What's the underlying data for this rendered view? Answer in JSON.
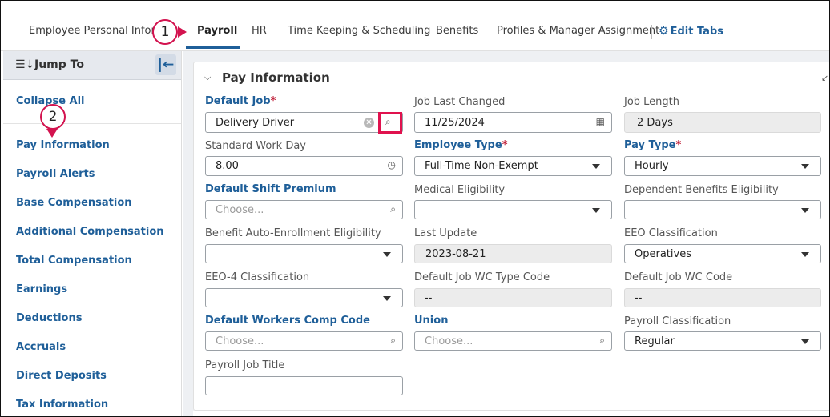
{
  "tabs": [
    {
      "label": "Employee Personal Informa"
    },
    {
      "label": "Payroll"
    },
    {
      "label": "HR"
    },
    {
      "label": "Time Keeping & Scheduling"
    },
    {
      "label": "Benefits"
    },
    {
      "label": "Profiles & Manager Assignment"
    }
  ],
  "edit_tabs_label": "Edit Tabs",
  "callouts": {
    "one": "1",
    "two": "2"
  },
  "sidebar": {
    "title": "Jump To",
    "collapse_all": "Collapse All",
    "items": [
      {
        "label": "Pay Information"
      },
      {
        "label": "Payroll Alerts"
      },
      {
        "label": "Base Compensation"
      },
      {
        "label": "Additional Compensation"
      },
      {
        "label": "Total Compensation"
      },
      {
        "label": "Earnings"
      },
      {
        "label": "Deductions"
      },
      {
        "label": "Accruals"
      },
      {
        "label": "Direct Deposits"
      },
      {
        "label": "Tax Information"
      }
    ]
  },
  "section": {
    "title": "Pay Information"
  },
  "fields": {
    "default_job": {
      "label": "Default Job",
      "required": "*",
      "value": "Delivery Driver"
    },
    "job_last_changed": {
      "label": "Job Last Changed",
      "value": "11/25/2024"
    },
    "job_length": {
      "label": "Job Length",
      "value": "2 Days"
    },
    "standard_work_day": {
      "label": "Standard Work Day",
      "value": "8.00"
    },
    "employee_type": {
      "label": "Employee Type",
      "required": "*",
      "value": "Full-Time Non-Exempt"
    },
    "pay_type": {
      "label": "Pay Type",
      "required": "*",
      "value": "Hourly"
    },
    "default_shift_premium": {
      "label": "Default Shift Premium",
      "placeholder": "Choose..."
    },
    "medical_eligibility": {
      "label": "Medical Eligibility",
      "value": ""
    },
    "dependent_benefits_eligibility": {
      "label": "Dependent Benefits Eligibility",
      "value": ""
    },
    "benefit_auto_enrollment": {
      "label": "Benefit Auto-Enrollment Eligibility",
      "value": ""
    },
    "last_update": {
      "label": "Last Update",
      "value": "2023-08-21"
    },
    "eeo_classification": {
      "label": "EEO Classification",
      "value": "Operatives"
    },
    "eeo4_classification": {
      "label": "EEO-4 Classification",
      "value": ""
    },
    "default_job_wc_type_code": {
      "label": "Default Job WC Type Code",
      "value": "--"
    },
    "default_job_wc_code": {
      "label": "Default Job WC Code",
      "value": "--"
    },
    "default_workers_comp_code": {
      "label": "Default Workers Comp Code",
      "placeholder": "Choose..."
    },
    "union": {
      "label": "Union",
      "placeholder": "Choose..."
    },
    "payroll_classification": {
      "label": "Payroll Classification",
      "value": "Regular"
    },
    "payroll_job_title": {
      "label": "Payroll Job Title",
      "value": ""
    }
  },
  "colors": {
    "link": "#1f5f99",
    "callout": "#d3134f",
    "required": "#c0223b"
  }
}
